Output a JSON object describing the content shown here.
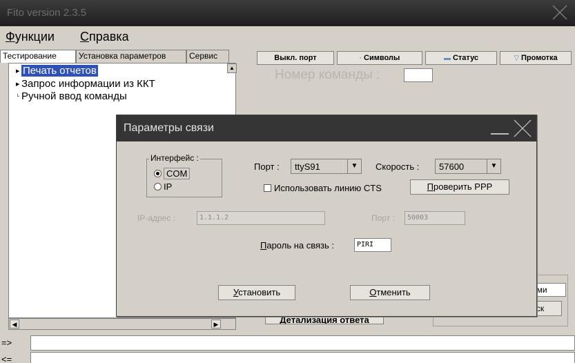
{
  "window": {
    "title": "Fito version 2.3.5"
  },
  "menu": {
    "functions": {
      "first": "Ф",
      "rest": "ункции"
    },
    "help": {
      "first": "С",
      "rest": "правка"
    }
  },
  "tabs": [
    {
      "label": "Тестирование",
      "active": true
    },
    {
      "label": "Установка параметров",
      "active": false
    },
    {
      "label": "Сервис",
      "active": false
    }
  ],
  "tree": {
    "items": [
      {
        "label": "Печать отчетов",
        "selected": true
      },
      {
        "label": "Запрос информации из ККТ",
        "selected": false
      },
      {
        "label": "Ручной ввод команды",
        "selected": false
      }
    ]
  },
  "toolbar": {
    "port_off": "Выкл. порт",
    "symbols": "Символы",
    "status": "Статус",
    "scroll": "Промотка"
  },
  "command": {
    "label": "Номер команды :"
  },
  "behind": {
    "field_partial": "ами",
    "button_partial": "уск",
    "detail_button": "Детализация ответа"
  },
  "cmdline": {
    "out_prompt": "=>",
    "in_prompt": "<="
  },
  "dialog": {
    "title": "Параметры связи",
    "interface_label": "Интерфейс :",
    "radio_com": "COM",
    "radio_ip": "IP",
    "port_label": "Порт :",
    "port_value": "ttyS91",
    "speed_label": "Скорость :",
    "speed_value": "57600",
    "cts_label": "Использовать линию CTS",
    "check_ppp": {
      "first": "П",
      "rest": "роверить PPP"
    },
    "ip_label": "IP-адрес :",
    "ip_value": "1.1.1.2",
    "ip_port_label": "Порт :",
    "ip_port_value": "50003",
    "password_label": {
      "first": "П",
      "rest": "ароль на связь :"
    },
    "password_value": "PIRI",
    "set_button": {
      "first": "У",
      "rest": "становить"
    },
    "cancel_button": {
      "first": "О",
      "rest": "тменить"
    }
  }
}
